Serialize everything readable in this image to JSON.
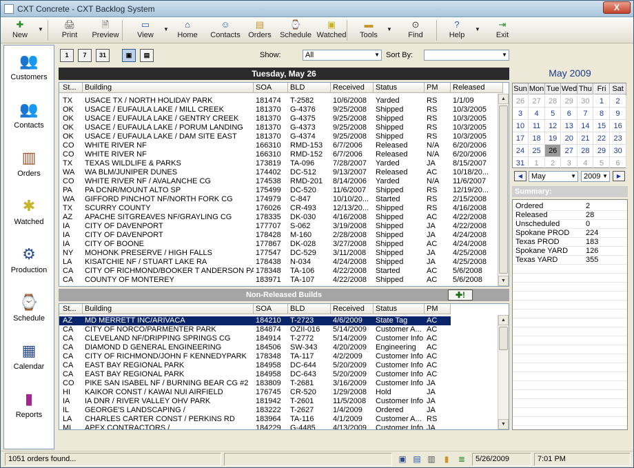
{
  "window": {
    "title": "CXT Concrete - CXT Backlog System",
    "close": "X"
  },
  "toolbar": [
    {
      "id": "new",
      "label": "New",
      "icon": "✚",
      "color": "#2a8a2a",
      "arrow": true
    },
    {
      "id": "print",
      "label": "Print",
      "icon": "🖨",
      "color": "#555"
    },
    {
      "id": "preview",
      "label": "Preview",
      "icon": "🗎",
      "color": "#555"
    },
    {
      "id": "view",
      "label": "View",
      "icon": "▭",
      "color": "#2a5aa8",
      "arrow": true
    },
    {
      "id": "home",
      "label": "Home",
      "icon": "⌂",
      "color": "#2a4a8a"
    },
    {
      "id": "contacts",
      "label": "Contacts",
      "icon": "☺",
      "color": "#2a6aa8"
    },
    {
      "id": "orders",
      "label": "Orders",
      "icon": "▤",
      "color": "#c8962a"
    },
    {
      "id": "schedule",
      "label": "Schedule",
      "icon": "⌚",
      "color": "#555"
    },
    {
      "id": "watched",
      "label": "Watched",
      "icon": "▣",
      "color": "#c8b42a"
    },
    {
      "id": "tools",
      "label": "Tools",
      "icon": "▬",
      "color": "#c8962a",
      "arrow": true
    },
    {
      "id": "find",
      "label": "Find",
      "icon": "⊙",
      "color": "#333"
    },
    {
      "id": "help",
      "label": "Help",
      "icon": "?",
      "color": "#2a5aa8",
      "arrow": true
    },
    {
      "id": "exit",
      "label": "Exit",
      "icon": "⇥",
      "color": "#2a8a2a"
    }
  ],
  "sidebar": [
    {
      "id": "customers",
      "label": "Customers",
      "icon": "👥",
      "color": "#c8a02a"
    },
    {
      "id": "contacts",
      "label": "Contacts",
      "icon": "👥",
      "color": "#2a8ac8"
    },
    {
      "id": "orders",
      "label": "Orders",
      "icon": "▥",
      "color": "#a0522d"
    },
    {
      "id": "watched",
      "label": "Watched",
      "icon": "✱",
      "color": "#c8b42a"
    },
    {
      "id": "production",
      "label": "Production",
      "icon": "⚙",
      "color": "#2a4a8a"
    },
    {
      "id": "schedule",
      "label": "Schedule",
      "icon": "⌚",
      "color": "#555"
    },
    {
      "id": "calendar",
      "label": "Calendar",
      "icon": "▦",
      "color": "#2a4a8a"
    },
    {
      "id": "reports",
      "label": "Reports",
      "icon": "▮",
      "color": "#a02a8a"
    }
  ],
  "viewbar": {
    "day": "1",
    "week": "7",
    "month": "31",
    "show_label": "Show:",
    "show_value": "All",
    "sort_label": "Sort By:",
    "sort_value": ""
  },
  "day_header": "Tuesday, May 26",
  "released": {
    "columns": [
      "St...",
      "Building",
      "SOA",
      "BLD",
      "Received",
      "Status",
      "PM",
      "Released"
    ],
    "rows": [
      [
        "TX",
        "USACE TX / NORTH HOLIDAY PARK",
        "181474",
        "T-2582",
        "10/6/2008",
        "Yarded",
        "RS",
        "1/1/09"
      ],
      [
        "OK",
        "USACE / EUFAULA LAKE / MILL CREEK",
        "181370",
        "G-4376",
        "9/25/2008",
        "Shipped",
        "RS",
        "10/3/2005"
      ],
      [
        "OK",
        "USACE / EUFAULA LAKE / GENTRY CREEK",
        "181370",
        "G-4375",
        "9/25/2008",
        "Shipped",
        "RS",
        "10/3/2005"
      ],
      [
        "OK",
        "USACE / EUFAULA LAKE / PORUM LANDING",
        "181370",
        "G-4373",
        "9/25/2008",
        "Shipped",
        "RS",
        "10/3/2005"
      ],
      [
        "OK",
        "USACE / EUFAULA LAKE / DAM SITE EAST",
        "181370",
        "G-4374",
        "9/25/2008",
        "Shipped",
        "RS",
        "10/3/2005"
      ],
      [
        "CO",
        "WHITE RIVER NF",
        "166310",
        "RMD-153",
        "6/7/2006",
        "Released",
        "N/A",
        "6/20/2006"
      ],
      [
        "CO",
        "WHITE RIVER NF",
        "166310",
        "RMD-152",
        "6/7/2006",
        "Released",
        "N/A",
        "6/20/2006"
      ],
      [
        "TX",
        "TEXAS WILDLIFE & PARKS",
        "173819",
        "TA-096",
        "7/28/2007",
        "Yarded",
        "JA",
        "8/15/2007"
      ],
      [
        "WA",
        "WA BLM/JUNIPER DUNES",
        "174402",
        "DC-512",
        "9/13/2007",
        "Released",
        "AC",
        "10/18/20..."
      ],
      [
        "CO",
        "WHITE RIVER NF / AVALANCHE CG",
        "174538",
        "RMD-201",
        "8/14/2006",
        "Yarded",
        "N/A",
        "11/6/2007"
      ],
      [
        "PA",
        "PA DCNR/MOUNT ALTO SP",
        "175499",
        "DC-520",
        "11/6/2007",
        "Shipped",
        "RS",
        "12/19/20..."
      ],
      [
        "WA",
        "GIFFORD PINCHOT NF/NORTH FORK CG",
        "174979",
        "C-847",
        "10/10/20...",
        "Started",
        "RS",
        "2/15/2008"
      ],
      [
        "TX",
        "SCURRY COUNTY",
        "176026",
        "CR-493",
        "12/13/20...",
        "Shipped",
        "RS",
        "4/16/2008"
      ],
      [
        "AZ",
        "APACHE SITGREAVES NF/GRAYLING CG",
        "178335",
        "DK-030",
        "4/16/2008",
        "Shipped",
        "AC",
        "4/22/2008"
      ],
      [
        "IA",
        "CITY OF DAVENPORT",
        "177707",
        "S-062",
        "3/19/2008",
        "Shipped",
        "JA",
        "4/22/2008"
      ],
      [
        "IA",
        "CITY OF DAVENPORT",
        "178428",
        "M-160",
        "2/28/2008",
        "Shipped",
        "JA",
        "4/24/2008"
      ],
      [
        "IA",
        "CITY OF BOONE",
        "177867",
        "DK-028",
        "3/27/2008",
        "Shipped",
        "AC",
        "4/24/2008"
      ],
      [
        "NY",
        "MOHONK PRESERVE / HIGH FALLS",
        "177547",
        "DC-529",
        "3/11/2008",
        "Shipped",
        "JA",
        "4/25/2008"
      ],
      [
        "LA",
        "KISATCHIE NF / STUART LAKE RA",
        "178438",
        "N-034",
        "4/24/2008",
        "Shipped",
        "JA",
        "4/25/2008"
      ],
      [
        "CA",
        "CITY OF RICHMOND/BOOKER T ANDERSON PA...",
        "178348",
        "TA-106",
        "4/22/2008",
        "Started",
        "AC",
        "5/6/2008"
      ],
      [
        "CA",
        "COUNTY OF MONTEREY",
        "183971",
        "TA-107",
        "4/22/2008",
        "Shipped",
        "AC",
        "5/6/2008"
      ]
    ]
  },
  "nonreleased": {
    "title": "Non-Released Builds",
    "add_button": "✚!",
    "columns": [
      "St...",
      "Building",
      "SOA",
      "BLD",
      "Received",
      "Status",
      "PM"
    ],
    "rows": [
      [
        "AZ",
        "MD MERRETT INC/ARIVACA",
        "184210",
        "T-2723",
        "4/6/2009",
        "State Tag",
        "AC"
      ],
      [
        "CA",
        "CITY OF NORCO/PARMENTER PARK",
        "184874",
        "OZII-016",
        "5/14/2009",
        "Customer A...",
        "AC"
      ],
      [
        "CA",
        "CLEVELAND NF/DRIPPING SPRINGS CG",
        "184914",
        "T-2772",
        "5/14/2009",
        "Customer Info",
        "AC"
      ],
      [
        "CA",
        "DIAMOND D GENERAL ENGINEERING",
        "184506",
        "SW-343",
        "4/20/2009",
        "Engineering",
        "AC"
      ],
      [
        "CA",
        "CITY OF RICHMOND/JOHN F KENNEDYPARK",
        "178348",
        "TA-117",
        "4/2/2009",
        "Customer Info",
        "AC"
      ],
      [
        "CA",
        "EAST BAY REGIONAL PARK",
        "184958",
        "DC-644",
        "5/20/2009",
        "Customer Info",
        "AC"
      ],
      [
        "CA",
        "EAST BAY REGIONAL PARK",
        "184958",
        "DC-643",
        "5/20/2009",
        "Customer Info",
        "AC"
      ],
      [
        "CO",
        "PIKE SAN ISABEL NF / BURNING BEAR CG #2",
        "183809",
        "T-2681",
        "3/16/2009",
        "Customer Info",
        "JA"
      ],
      [
        "HI",
        "KAIKOR CONST / KAWAI NUI AIRFIELD",
        "176745",
        "CR-520",
        "1/29/2008",
        "Hold",
        "JA"
      ],
      [
        "IA",
        "IA DNR / RIVER VALLEY OHV PARK",
        "181942",
        "T-2601",
        "11/5/2008",
        "Customer Info",
        "JA"
      ],
      [
        "IL",
        "GEORGE'S LANDSCAPING /",
        "183222",
        "T-2627",
        "1/4/2009",
        "Ordered",
        "JA"
      ],
      [
        "LA",
        "CHARLES CARTER CONST / PERKINS RD",
        "183964",
        "TA-116",
        "4/1/2009",
        "Customer A...",
        "RS"
      ],
      [
        "MI",
        "APEX CONTRACTORS /",
        "184229",
        "G-4485",
        "4/13/2009",
        "Customer Info",
        "JA"
      ]
    ]
  },
  "calendar": {
    "title": "May 2009",
    "weekdays": [
      "Sun",
      "Mon",
      "Tue",
      "Wed",
      "Thu",
      "Fri",
      "Sat"
    ],
    "weeks": [
      [
        "26",
        "27",
        "28",
        "29",
        "30",
        "1",
        "2"
      ],
      [
        "3",
        "4",
        "5",
        "6",
        "7",
        "8",
        "9"
      ],
      [
        "10",
        "11",
        "12",
        "13",
        "14",
        "15",
        "16"
      ],
      [
        "17",
        "18",
        "19",
        "20",
        "21",
        "22",
        "23"
      ],
      [
        "24",
        "25",
        "26",
        "27",
        "28",
        "29",
        "30"
      ],
      [
        "31",
        "1",
        "2",
        "3",
        "4",
        "5",
        "6"
      ]
    ],
    "month_value": "May",
    "year_value": "2009"
  },
  "summary": {
    "title": "Summary:",
    "items": [
      [
        "Ordered",
        "2"
      ],
      [
        "Released",
        "28"
      ],
      [
        "Unscheduled",
        "0"
      ],
      [
        "Spokane PROD",
        "224"
      ],
      [
        "Texas PROD",
        "183"
      ],
      [
        "Spokane YARD",
        "126"
      ],
      [
        "Texas YARD",
        "355"
      ]
    ]
  },
  "statusbar": {
    "message": "1051 orders found...",
    "date": "5/26/2009",
    "time": "7:01 PM"
  }
}
